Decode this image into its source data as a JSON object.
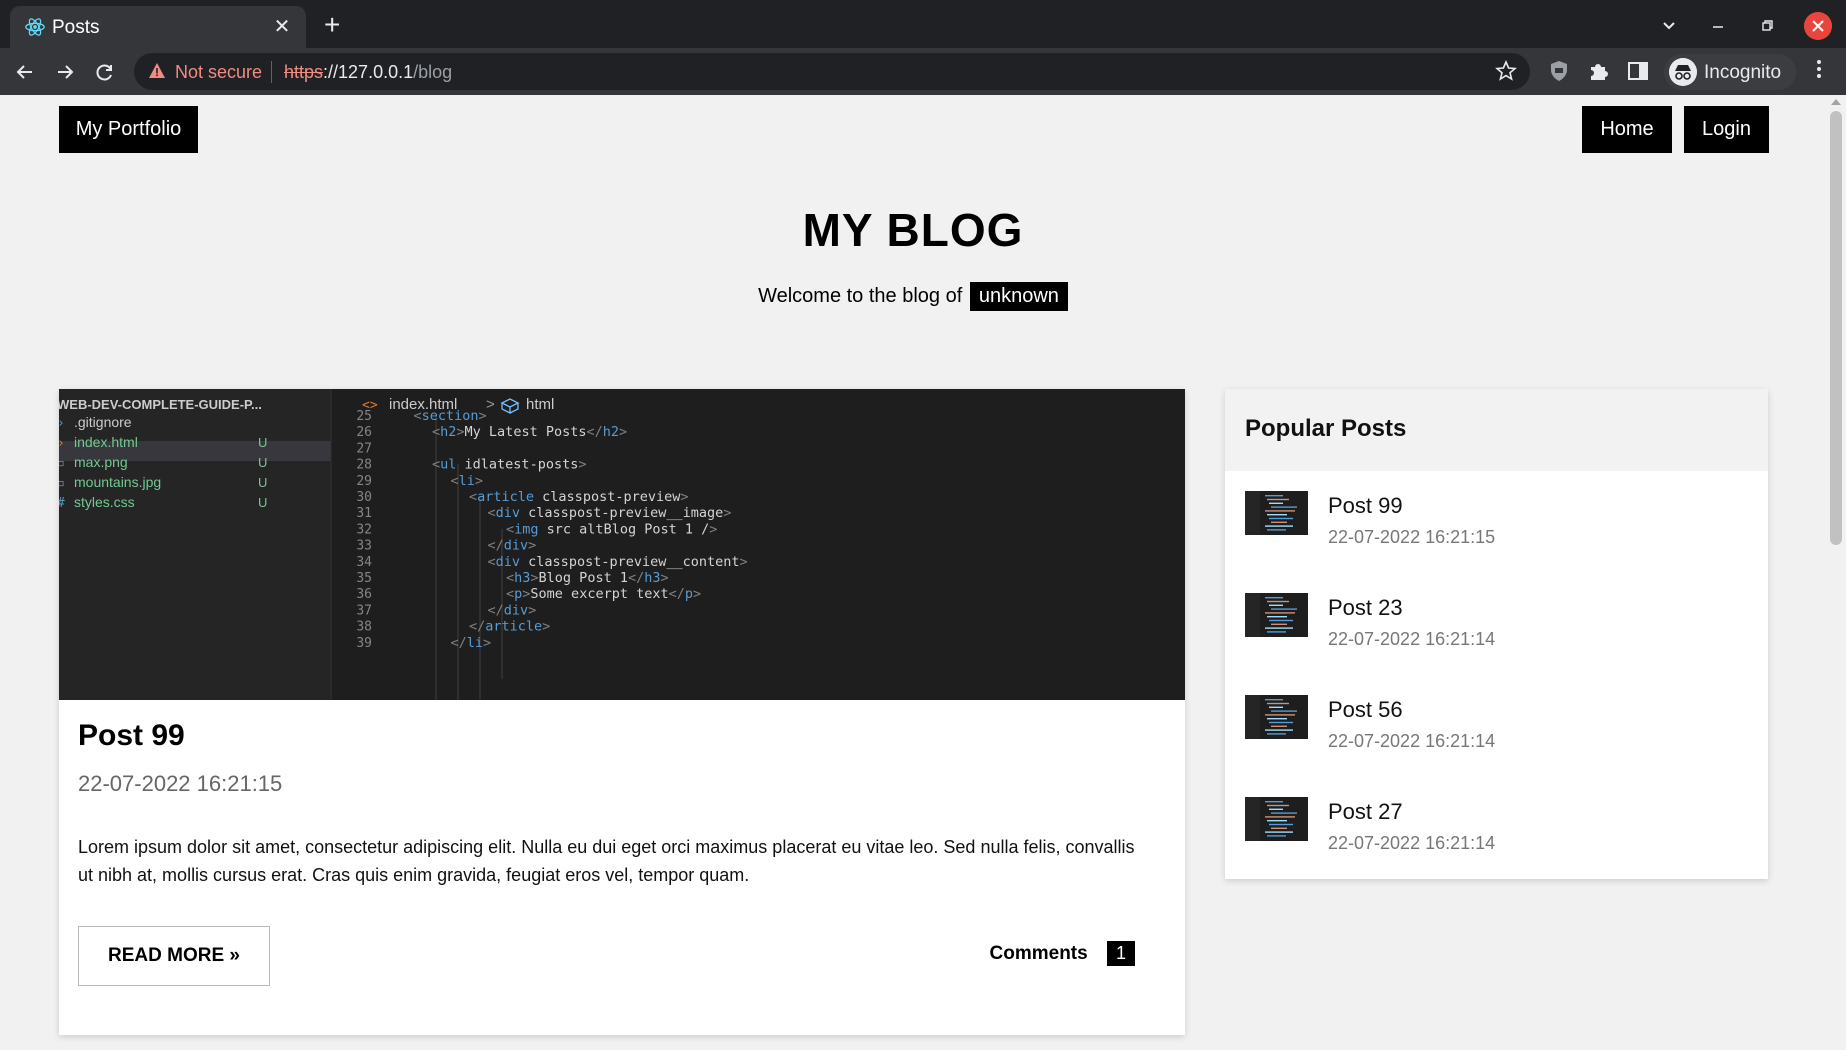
{
  "browser": {
    "tab_title": "Posts",
    "tab_close": "✕",
    "new_tab": "+",
    "warning_label": "Not secure",
    "url_scheme": "https",
    "url_host": "://127.0.0.1",
    "url_path": "/blog",
    "incognito_label": "Incognito"
  },
  "nav": {
    "brand": "My Portfolio",
    "home": "Home",
    "login": "Login"
  },
  "hero": {
    "title": "MY BLOG",
    "welcome": "Welcome to the blog of",
    "user": "unknown"
  },
  "editor": {
    "explorer_title": "WEB-DEV-COMPLETE-GUIDE-P...",
    "files": [
      {
        "name": ".gitignore",
        "status": "",
        "color": "#cccccc"
      },
      {
        "name": "index.html",
        "status": "U",
        "color": "#73c991"
      },
      {
        "name": "max.png",
        "status": "U",
        "color": "#73c991"
      },
      {
        "name": "mountains.jpg",
        "status": "U",
        "color": "#73c991"
      },
      {
        "name": "styles.css",
        "status": "U",
        "color": "#73c991"
      }
    ],
    "breadcrumb_file": "index.html",
    "breadcrumb_sep": ">",
    "breadcrumb_node": "html",
    "lines": [
      {
        "n": "25",
        "indent": 1,
        "code": "<section>"
      },
      {
        "n": "26",
        "indent": 2,
        "code": "<h2>My Latest Posts</h2>"
      },
      {
        "n": "27",
        "indent": 0,
        "code": ""
      },
      {
        "n": "28",
        "indent": 2,
        "code": "<ul id=\"latest-posts\">"
      },
      {
        "n": "29",
        "indent": 3,
        "code": "<li>"
      },
      {
        "n": "30",
        "indent": 4,
        "code": "<article class=\"post-preview\">"
      },
      {
        "n": "31",
        "indent": 5,
        "code": "<div class=\"post-preview__image\">"
      },
      {
        "n": "32",
        "indent": 6,
        "code": "<img src=\"\" alt=\"Blog Post 1\" />"
      },
      {
        "n": "33",
        "indent": 5,
        "code": "</div>"
      },
      {
        "n": "34",
        "indent": 5,
        "code": "<div class=\"post-preview__content\">"
      },
      {
        "n": "35",
        "indent": 6,
        "code": "<h3>Blog Post 1</h3>"
      },
      {
        "n": "36",
        "indent": 6,
        "code": "<p>Some excerpt text</p>"
      },
      {
        "n": "37",
        "indent": 5,
        "code": "</div>"
      },
      {
        "n": "38",
        "indent": 4,
        "code": "</article>"
      },
      {
        "n": "39",
        "indent": 3,
        "code": "</li>"
      }
    ]
  },
  "post": {
    "title": "Post 99",
    "date": "22-07-2022 16:21:15",
    "excerpt": "Lorem ipsum dolor sit amet, consectetur adipiscing elit. Nulla eu dui eget orci maximus placerat eu vitae leo. Sed nulla felis, convallis ut nibh at, mollis cursus erat. Cras quis enim gravida, feugiat eros vel, tempor quam.",
    "read_more": "READ MORE »",
    "comments_label": "Comments",
    "comments_count": "1"
  },
  "popular": {
    "title": "Popular Posts",
    "items": [
      {
        "title": "Post 99",
        "date": "22-07-2022 16:21:15"
      },
      {
        "title": "Post 23",
        "date": "22-07-2022 16:21:14"
      },
      {
        "title": "Post 56",
        "date": "22-07-2022 16:21:14"
      },
      {
        "title": "Post 27",
        "date": "22-07-2022 16:21:14"
      }
    ]
  },
  "colors": {
    "page_bg": "#f1f1f1",
    "accent": "#000000",
    "chrome_dark": "#202124",
    "chrome_toolbar": "#35363a",
    "warning": "#f28b82",
    "editor_bg": "#1e1e1e"
  },
  "icons": [
    "react-favicon-icon",
    "close-icon",
    "plus-icon",
    "chevron-down-icon",
    "minimize-icon",
    "restore-icon",
    "back-arrow-icon",
    "forward-arrow-icon",
    "reload-icon",
    "warning-icon",
    "star-icon",
    "shield-extension-icon",
    "puzzle-icon",
    "sidepanel-icon",
    "incognito-icon",
    "kebab-menu-icon"
  ]
}
